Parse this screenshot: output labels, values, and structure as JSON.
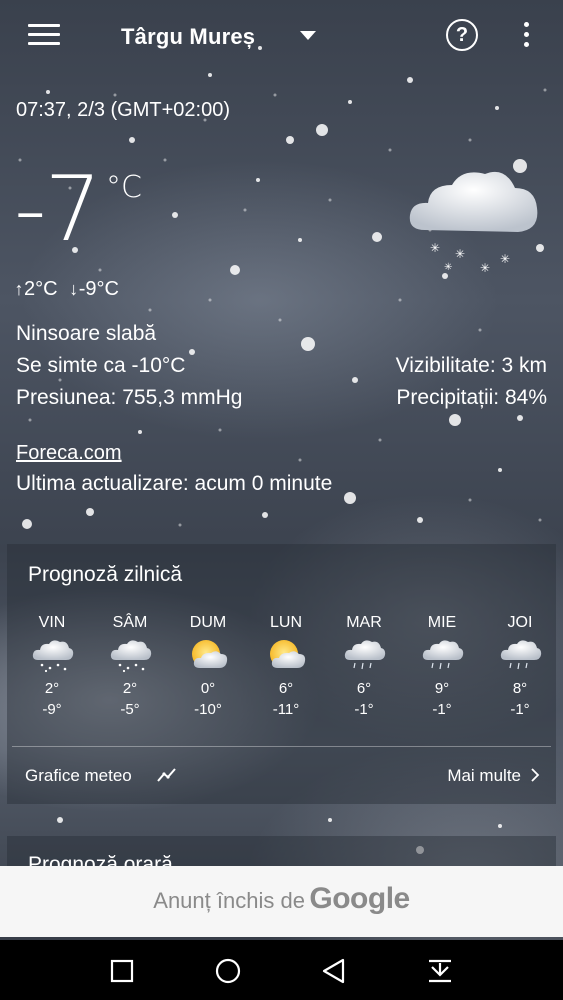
{
  "header": {
    "city": "Târgu Mureș"
  },
  "time": "07:37, 2/3 (GMT+02:00)",
  "current": {
    "temp": "-7",
    "unit": "°C",
    "high": "2°C",
    "low": "-9°C",
    "condition": "Ninsoare slabă",
    "feels_like": "Se simte ca -10°C",
    "pressure": "Presiunea: 755,3 mmHg",
    "visibility": "Vizibilitate: 3 km",
    "precipitation": "Precipitații: 84%",
    "icon": "cloud-snow-icon"
  },
  "source": "Foreca.com",
  "updated": "Ultima actualizare: acum 0 minute",
  "daily": {
    "title": "Prognoză zilnică",
    "days": [
      {
        "name": "VIN",
        "hi": "2°",
        "lo": "-9°",
        "icon": "cloud-snow-icon"
      },
      {
        "name": "SÂM",
        "hi": "2°",
        "lo": "-5°",
        "icon": "cloud-snow-icon"
      },
      {
        "name": "DUM",
        "hi": "0°",
        "lo": "-10°",
        "icon": "sun-cloud-icon"
      },
      {
        "name": "LUN",
        "hi": "6°",
        "lo": "-11°",
        "icon": "sun-cloud-icon"
      },
      {
        "name": "MAR",
        "hi": "6°",
        "lo": "-1°",
        "icon": "cloud-rain-icon"
      },
      {
        "name": "MIE",
        "hi": "9°",
        "lo": "-1°",
        "icon": "cloud-rain-icon"
      },
      {
        "name": "JOI",
        "hi": "8°",
        "lo": "-1°",
        "icon": "cloud-rain-icon"
      }
    ],
    "charts_label": "Grafice meteo",
    "more_label": "Mai multe"
  },
  "hourly": {
    "title": "Prognoză orară"
  },
  "ad": {
    "text": "Anunț închis de",
    "brand": "Google"
  }
}
